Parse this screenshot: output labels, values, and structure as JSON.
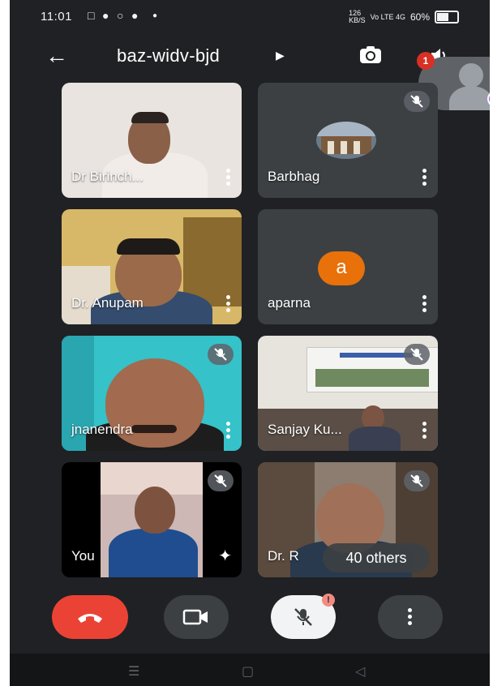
{
  "status_bar": {
    "time": "11:01",
    "network_speed": "126\nKB/S",
    "signal": "Vo LTE 4G",
    "battery": "60%"
  },
  "header": {
    "back_icon": "arrow-left-icon",
    "meeting_code": "baz-widv-bjd",
    "switch_camera_icon": "camera-switch-icon",
    "speaker_icon": "speaker-icon"
  },
  "self_preview": {
    "notification_count": "1"
  },
  "participants": [
    {
      "name": "Dr Birinch...",
      "muted": false
    },
    {
      "name": "Barbhag",
      "muted": true
    },
    {
      "name": "Dr. Anupam",
      "muted": false
    },
    {
      "name": "aparna",
      "muted": false,
      "avatar_letter": "a"
    },
    {
      "name": "jnanendra",
      "muted": true
    },
    {
      "name": "Sanjay Ku...",
      "muted": true
    },
    {
      "name": "You",
      "muted": true
    },
    {
      "name": "Dr. R",
      "muted": true
    }
  ],
  "others_chip": "40 others",
  "controls": {
    "end_call_icon": "phone-hangup-icon",
    "camera_icon": "video-camera-icon",
    "mic_icon": "mic-off-icon",
    "mic_alert": "!",
    "more_icon": "more-vert-icon"
  },
  "colors": {
    "background": "#202124",
    "tile": "#3c4043",
    "end_call": "#ea4335",
    "avatar_orange": "#e8710a"
  }
}
